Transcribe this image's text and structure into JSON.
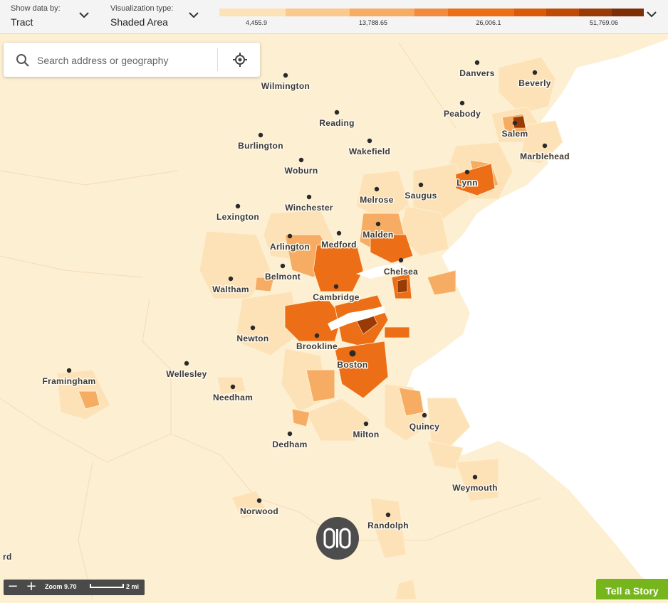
{
  "controls": {
    "show_data_by": {
      "caption": "Show data by:",
      "value": "Tract"
    },
    "visualization": {
      "caption": "Visualization type:",
      "value": "Shaded Area"
    }
  },
  "legend": {
    "colors": [
      "#fde2b8",
      "#fbc98c",
      "#f7ac63",
      "#f28b3b",
      "#ec6e16",
      "#da5a0a",
      "#bf4a06",
      "#9a3b05",
      "#7d2e05"
    ],
    "ticks": [
      "4,455.9",
      "13,788.65",
      "26,006.1",
      "51,769.06"
    ]
  },
  "search": {
    "placeholder": "Search address or geography"
  },
  "cities": [
    "Danvers",
    "Beverly",
    "Wilmington",
    "Peabody",
    "Salem",
    "Reading",
    "Burlington",
    "Wakefield",
    "Marblehead",
    "Woburn",
    "Lynn",
    "Saugus",
    "Melrose",
    "Winchester",
    "Lexington",
    "Malden",
    "Arlington",
    "Medford",
    "Chelsea",
    "Belmont",
    "Waltham",
    "Cambridge",
    "Newton",
    "Brookline",
    "Boston",
    "Framingham",
    "Wellesley",
    "Needham",
    "Quincy",
    "Milton",
    "Dedham",
    "Weymouth",
    "Norwood",
    "Randolph",
    "rd"
  ],
  "zoom": {
    "minus": "−",
    "plus": "+",
    "level_text": "Zoom 9.70",
    "scale_text": "2 mi"
  },
  "story_button": "Tell a Story"
}
